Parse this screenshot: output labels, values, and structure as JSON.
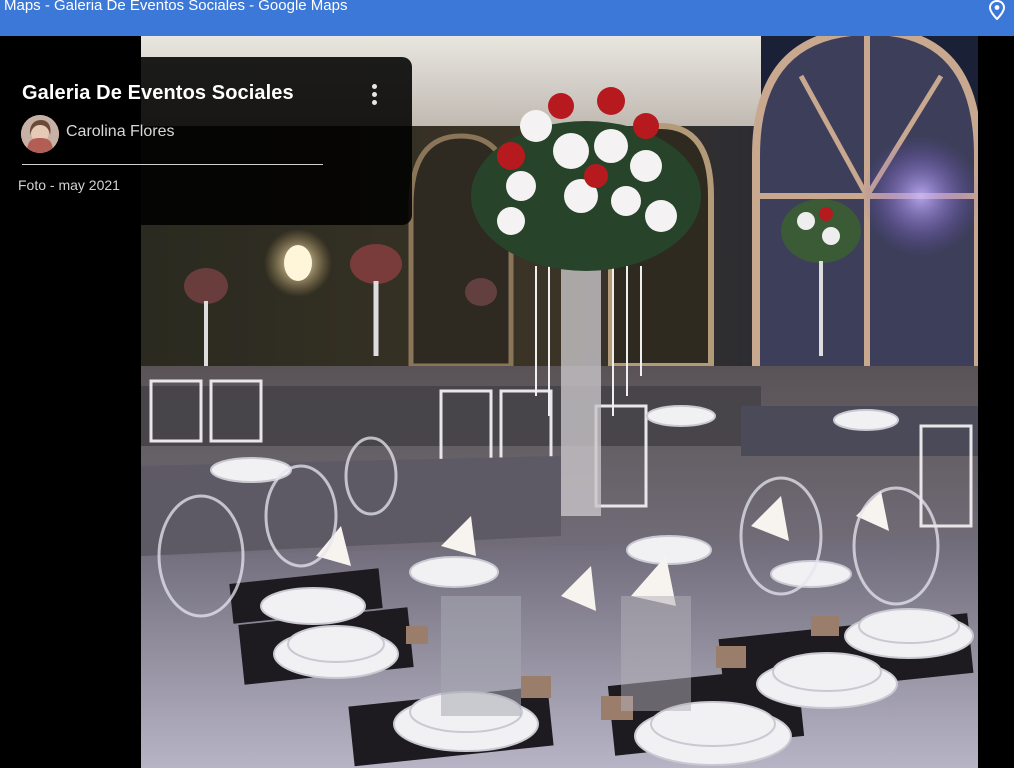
{
  "window": {
    "title": "Maps - Galeria De Eventos Sociales - Google Maps",
    "icon": "map-pin-icon"
  },
  "info_card": {
    "title": "Galeria De Eventos Sociales",
    "author": "Carolina Flores",
    "date": "Foto - may 2021",
    "menu_icon": "more-vert-icon"
  },
  "photo": {
    "subject": "Event hall with set banquet tables and floral centerpieces"
  },
  "colors": {
    "titlebar": "#3c78d8",
    "card_bg": "#000000",
    "text_primary": "#ffffff",
    "text_secondary": "#d8d8d8"
  }
}
